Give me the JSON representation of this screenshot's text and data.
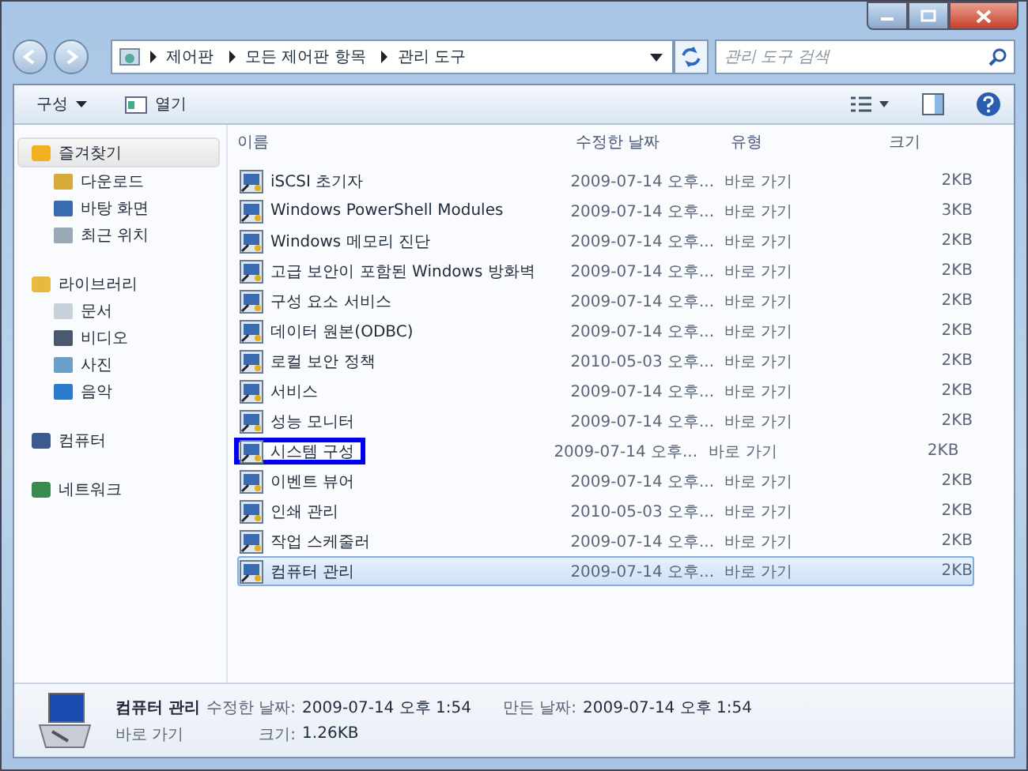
{
  "breadcrumb": [
    "제어판",
    "모든 제어판 항목",
    "관리 도구"
  ],
  "search": {
    "placeholder": "관리 도구 검색"
  },
  "toolbar": {
    "organize": "구성",
    "open": "열기"
  },
  "sidebar": {
    "groups": [
      {
        "label": "즐겨찾기",
        "selected": true,
        "children": [
          {
            "label": "다운로드"
          },
          {
            "label": "바탕 화면"
          },
          {
            "label": "최근 위치"
          }
        ]
      },
      {
        "label": "라이브러리",
        "selected": false,
        "children": [
          {
            "label": "문서"
          },
          {
            "label": "비디오"
          },
          {
            "label": "사진"
          },
          {
            "label": "음악"
          }
        ]
      },
      {
        "label": "컴퓨터",
        "selected": false
      },
      {
        "label": "네트워크",
        "selected": false
      }
    ]
  },
  "table": {
    "columns": [
      "이름",
      "수정한 날짜",
      "유형",
      "크기"
    ],
    "rows": [
      {
        "name": "iSCSI 초기자",
        "date": "2009-07-14 오후...",
        "type": "바로 가기",
        "size": "2KB",
        "selected": false,
        "highlighted": false
      },
      {
        "name": "Windows PowerShell Modules",
        "date": "2009-07-14 오후...",
        "type": "바로 가기",
        "size": "3KB",
        "selected": false,
        "highlighted": false
      },
      {
        "name": "Windows 메모리 진단",
        "date": "2009-07-14 오후...",
        "type": "바로 가기",
        "size": "2KB",
        "selected": false,
        "highlighted": false
      },
      {
        "name": "고급 보안이 포함된 Windows 방화벽",
        "date": "2009-07-14 오후...",
        "type": "바로 가기",
        "size": "2KB",
        "selected": false,
        "highlighted": false
      },
      {
        "name": "구성 요소 서비스",
        "date": "2009-07-14 오후...",
        "type": "바로 가기",
        "size": "2KB",
        "selected": false,
        "highlighted": false
      },
      {
        "name": "데이터 원본(ODBC)",
        "date": "2009-07-14 오후...",
        "type": "바로 가기",
        "size": "2KB",
        "selected": false,
        "highlighted": false
      },
      {
        "name": "로컬 보안 정책",
        "date": "2010-05-03 오후...",
        "type": "바로 가기",
        "size": "2KB",
        "selected": false,
        "highlighted": false
      },
      {
        "name": "서비스",
        "date": "2009-07-14 오후...",
        "type": "바로 가기",
        "size": "2KB",
        "selected": false,
        "highlighted": false
      },
      {
        "name": "성능 모니터",
        "date": "2009-07-14 오후...",
        "type": "바로 가기",
        "size": "2KB",
        "selected": false,
        "highlighted": false
      },
      {
        "name": "시스템 구성",
        "date": "2009-07-14 오후...",
        "type": "바로 가기",
        "size": "2KB",
        "selected": false,
        "highlighted": true
      },
      {
        "name": "이벤트 뷰어",
        "date": "2009-07-14 오후...",
        "type": "바로 가기",
        "size": "2KB",
        "selected": false,
        "highlighted": false
      },
      {
        "name": "인쇄 관리",
        "date": "2010-05-03 오후...",
        "type": "바로 가기",
        "size": "2KB",
        "selected": false,
        "highlighted": false
      },
      {
        "name": "작업 스케줄러",
        "date": "2009-07-14 오후...",
        "type": "바로 가기",
        "size": "2KB",
        "selected": false,
        "highlighted": false
      },
      {
        "name": "컴퓨터 관리",
        "date": "2009-07-14 오후...",
        "type": "바로 가기",
        "size": "2KB",
        "selected": true,
        "highlighted": false
      }
    ]
  },
  "details": {
    "name": "컴퓨터 관리",
    "kind": "바로 가기",
    "modified_label": "수정한 날짜:",
    "modified": "2009-07-14 오후 1:54",
    "created_label": "만든 날짜:",
    "created": "2009-07-14 오후 1:54",
    "size_label": "크기:",
    "size": "1.26KB"
  }
}
